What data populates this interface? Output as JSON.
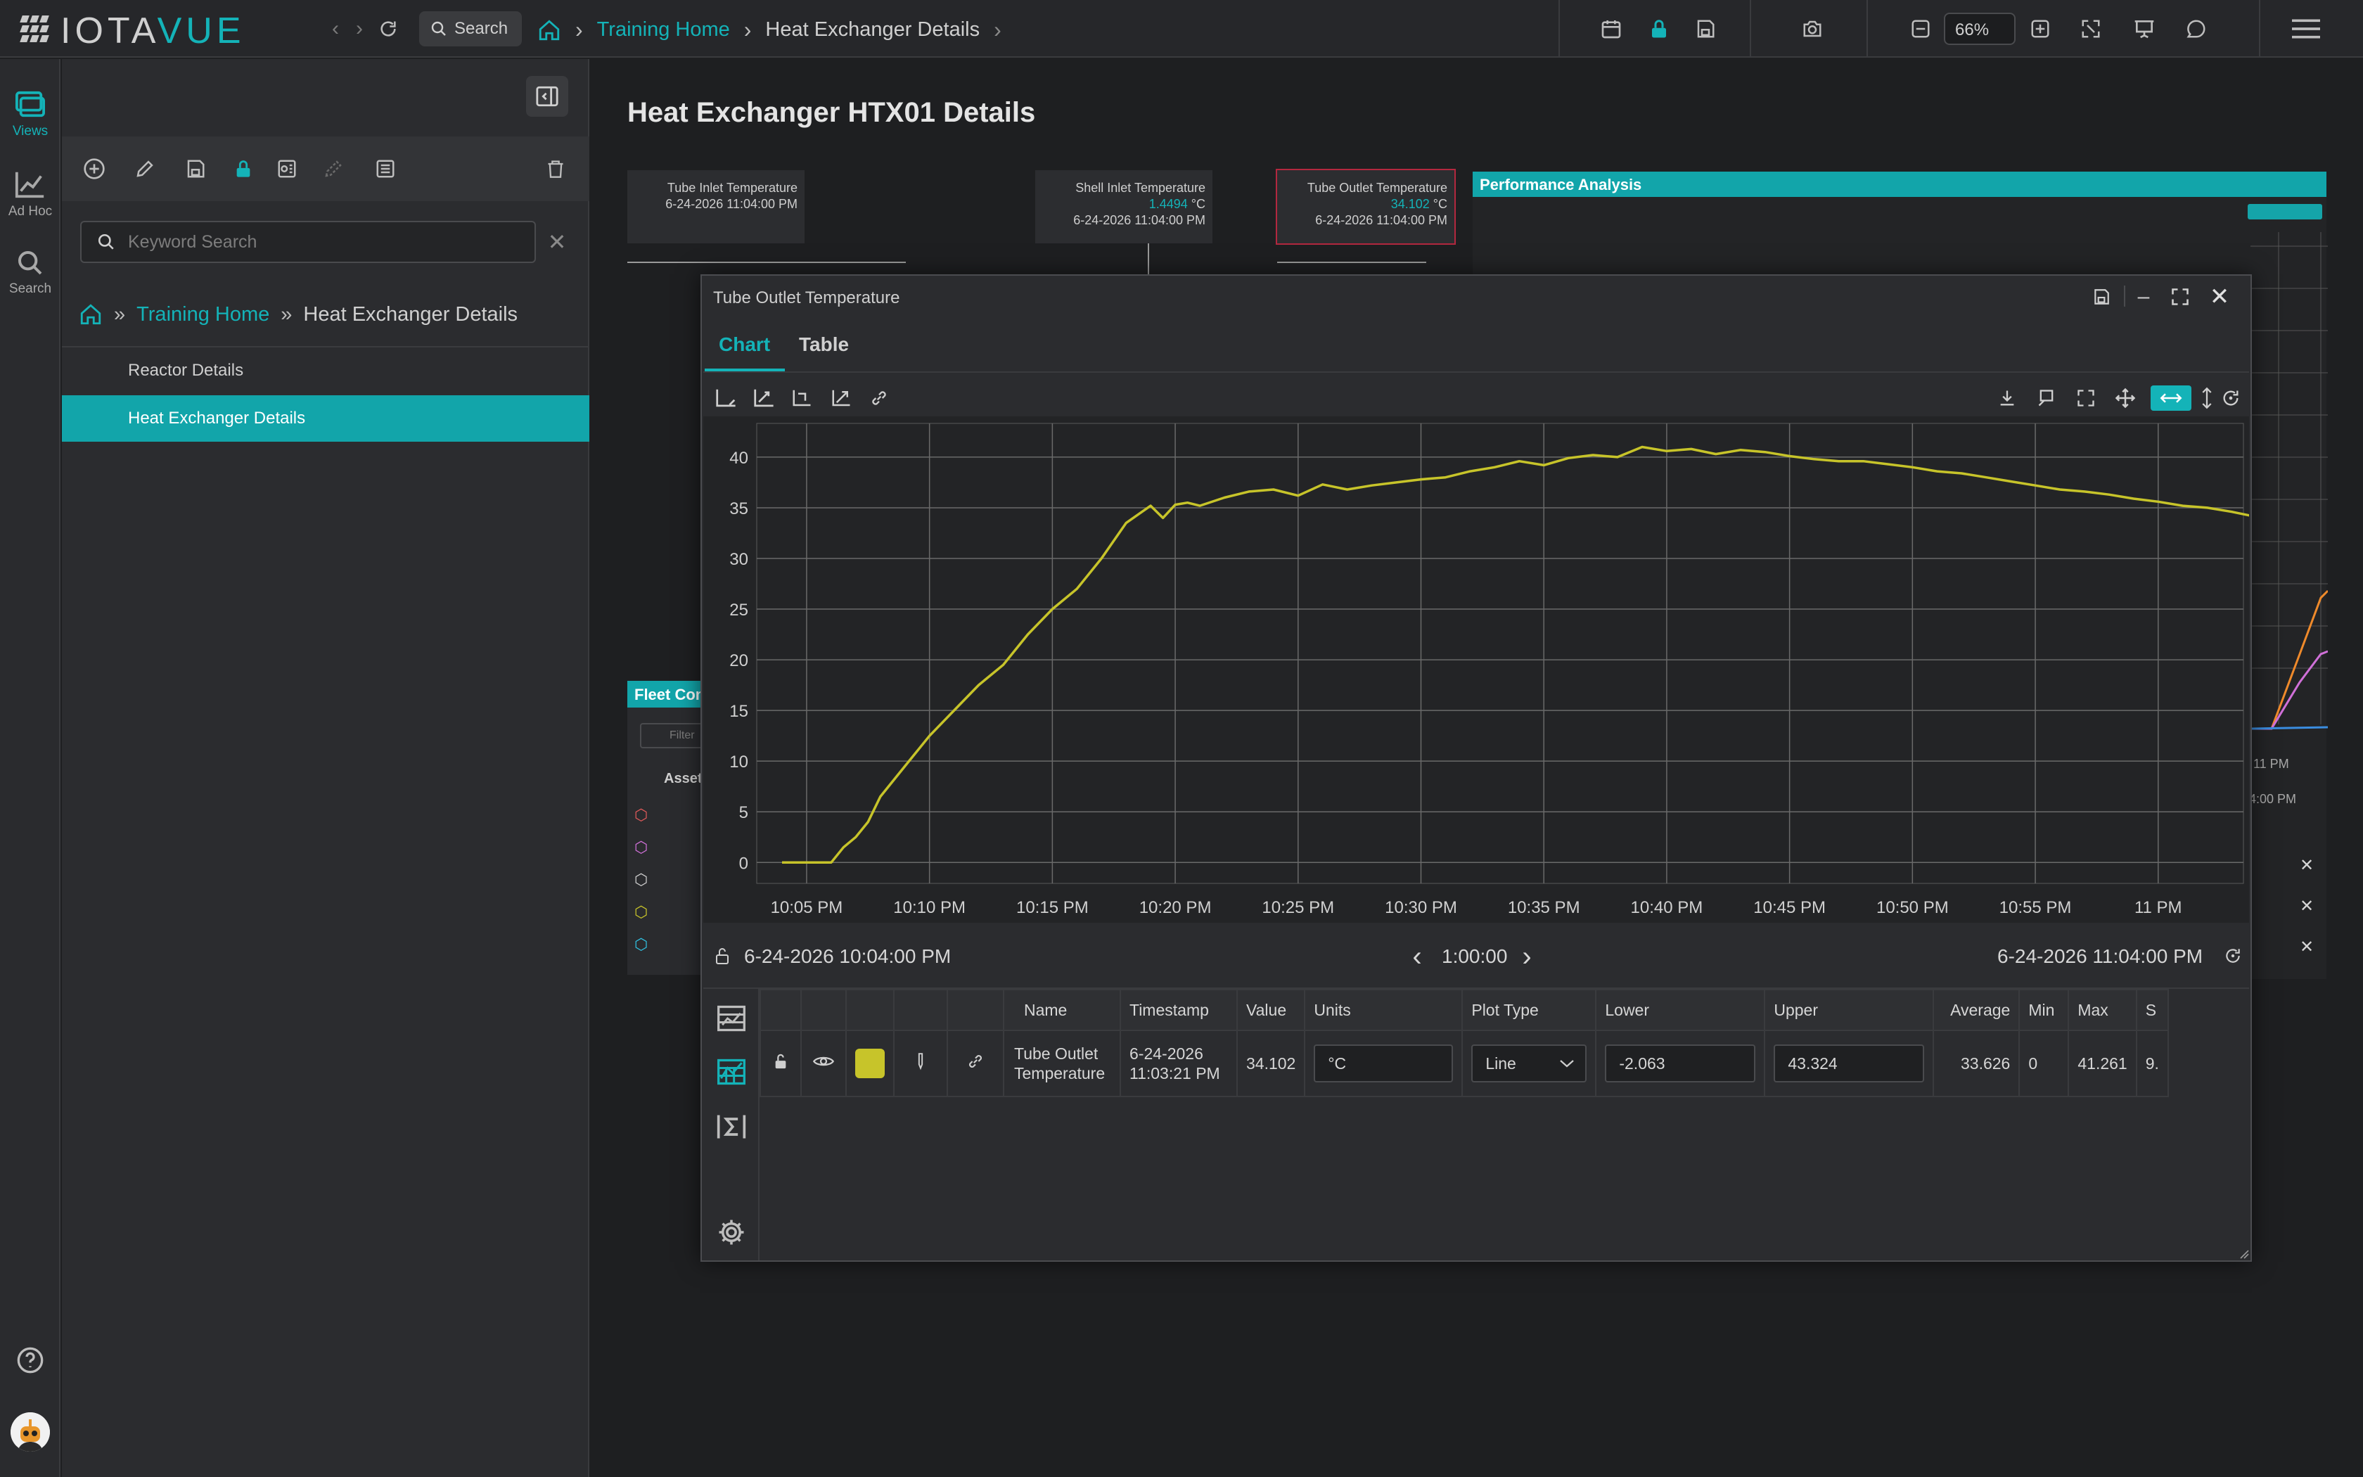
{
  "app": {
    "logo_prefix": "IOTA",
    "logo_accent": "VUE"
  },
  "header": {
    "search_label": "Search",
    "breadcrumb": [
      "Training Home",
      "Heat Exchanger Details"
    ],
    "zoom": "66%"
  },
  "rail": {
    "views": "Views",
    "adhoc": "Ad Hoc",
    "search": "Search"
  },
  "sidebar": {
    "search_placeholder": "Keyword Search",
    "breadcrumb": [
      "Training Home",
      "Heat Exchanger Details"
    ],
    "items": [
      {
        "label": "Reactor Details"
      },
      {
        "label": "Heat Exchanger Details"
      }
    ]
  },
  "page": {
    "title": "Heat Exchanger HTX01 Details",
    "tiles": [
      {
        "name": "Tube Inlet Temperature",
        "value": "",
        "unit": "",
        "time": "6-24-2026 11:04:00 PM"
      },
      {
        "name": "Shell Inlet Temperature",
        "value": "1.4494",
        "unit": "°C",
        "time": "6-24-2026 11:04:00 PM"
      },
      {
        "name": "Tube Outlet Temperature",
        "value": "34.102",
        "unit": "°C",
        "time": "6-24-2026 11:04:00 PM"
      }
    ],
    "perf_title": "Performance Analysis",
    "fleet_title": "Fleet Com",
    "fleet_filter": "Filter",
    "fleet_col": "Asset",
    "perf_time_partial": "11 PM",
    "perf_end_partial": "4:00 PM"
  },
  "dialog": {
    "title": "Tube Outlet Temperature",
    "tabs": [
      "Chart",
      "Table"
    ],
    "start": "6-24-2026 10:04:00 PM",
    "end": "6-24-2026 11:04:00 PM",
    "duration": "1:00:00",
    "columns": [
      "Name",
      "Timestamp",
      "Value",
      "Units",
      "Plot Type",
      "Lower",
      "Upper",
      "Average",
      "Min",
      "Max",
      "S"
    ],
    "row": {
      "name": "Tube Outlet Temperature",
      "timestamp": "6-24-2026 11:03:21 PM",
      "value": "34.102",
      "units": "°C",
      "plot_type": "Line",
      "lower": "-2.063",
      "upper": "43.324",
      "average": "33.626",
      "min": "0",
      "max": "41.261",
      "s": "9."
    }
  },
  "chart_data": {
    "type": "line",
    "title": "",
    "xlabel": "",
    "ylabel": "",
    "ylim": [
      -2.063,
      43.324
    ],
    "yticks": [
      0,
      5,
      10,
      15,
      20,
      25,
      30,
      35,
      40
    ],
    "xticks": [
      "10:05 PM",
      "10:10 PM",
      "10:15 PM",
      "10:20 PM",
      "10:25 PM",
      "10:30 PM",
      "10:35 PM",
      "10:40 PM",
      "10:45 PM",
      "10:50 PM",
      "10:55 PM",
      "11 PM"
    ],
    "x_minutes_range": [
      0,
      60
    ],
    "color": "#c7c42a",
    "grid": true,
    "series": [
      {
        "x": [
          0,
          1,
          1.5,
          2,
          2.5,
          3,
          3.5,
          4,
          5,
          6,
          7,
          8,
          9,
          10,
          11,
          12,
          13,
          14,
          15,
          15.5,
          16,
          16.5,
          17,
          18,
          19,
          20,
          21,
          22,
          23,
          24,
          25,
          26,
          27,
          28,
          29,
          30,
          31,
          32,
          33,
          34,
          35,
          36,
          37,
          38,
          39,
          40,
          41,
          42,
          43,
          44,
          45,
          46,
          47,
          48,
          49,
          50,
          51,
          52,
          53,
          54,
          55,
          56,
          57,
          58,
          59,
          60
        ],
        "y": [
          0,
          0,
          0,
          0,
          1.5,
          2.5,
          4,
          6.5,
          9.5,
          12.5,
          15,
          17.5,
          19.5,
          22.5,
          25,
          27,
          30,
          33.5,
          35.2,
          34,
          35.3,
          35.5,
          35.2,
          36,
          36.6,
          36.8,
          36.2,
          37.3,
          36.8,
          37.2,
          37.5,
          37.8,
          38.0,
          38.6,
          39.0,
          39.6,
          39.2,
          39.9,
          40.2,
          40.0,
          41.0,
          40.6,
          40.8,
          40.3,
          40.7,
          40.5,
          40.1,
          39.8,
          39.6,
          39.6,
          39.3,
          39.0,
          38.6,
          38.4,
          38.0,
          37.6,
          37.2,
          36.8,
          36.6,
          36.3,
          35.9,
          35.6,
          35.2,
          35.0,
          34.6,
          34.1
        ]
      }
    ]
  }
}
